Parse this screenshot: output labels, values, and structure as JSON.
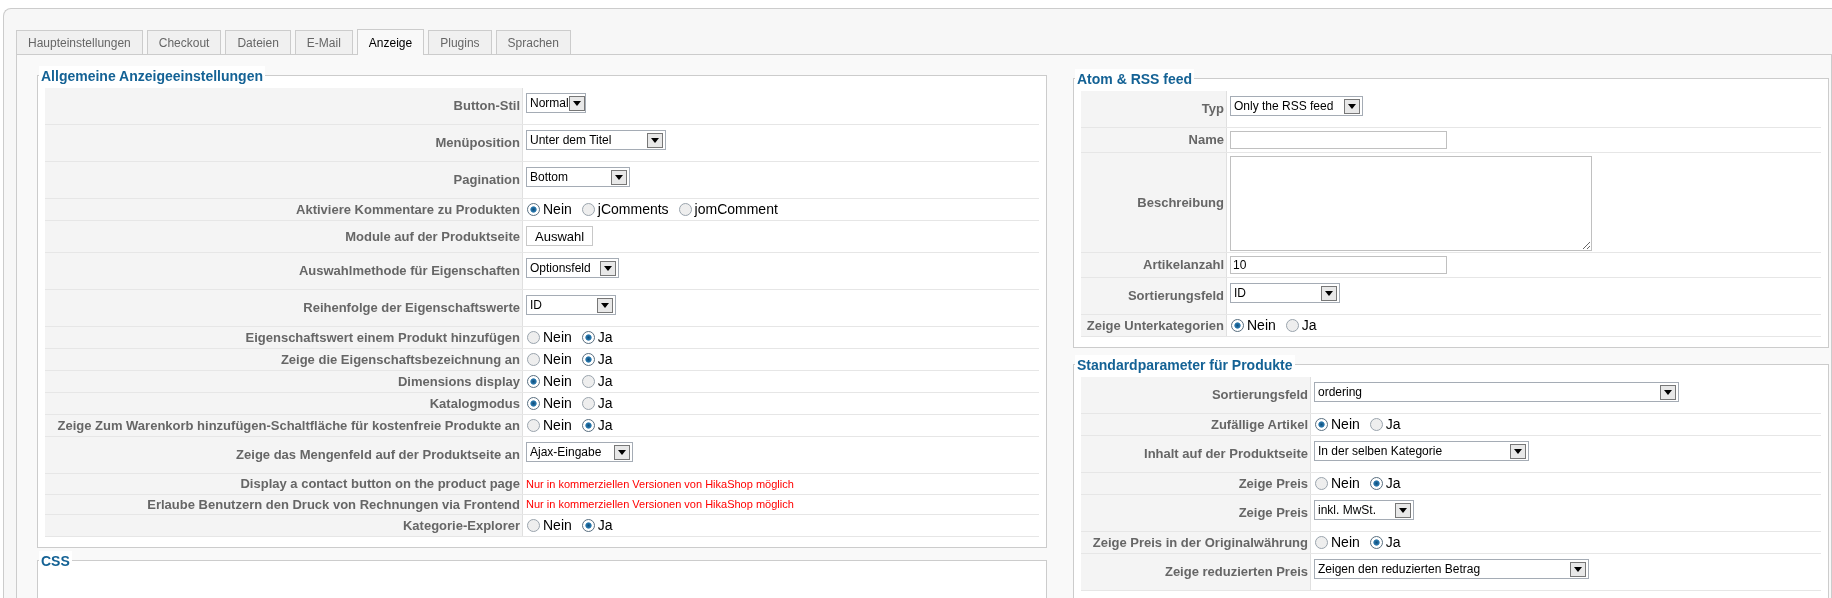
{
  "tabs": [
    {
      "label": "Haupteinstellungen",
      "selected": false
    },
    {
      "label": "Checkout",
      "selected": false
    },
    {
      "label": "Dateien",
      "selected": false
    },
    {
      "label": "E-Mail",
      "selected": false
    },
    {
      "label": "Anzeige",
      "selected": true
    },
    {
      "label": "Plugins",
      "selected": false
    },
    {
      "label": "Sprachen",
      "selected": false
    }
  ],
  "left_sections": [
    {
      "title": "Allgemeine Anzeigeeinstellungen",
      "rows": [
        {
          "label": "Button-Stil",
          "kind": "select",
          "value": "Normal"
        },
        {
          "label": "Menüposition",
          "kind": "select",
          "value": "Unter dem Titel"
        },
        {
          "label": "Pagination",
          "kind": "select",
          "value": "Bottom"
        },
        {
          "label": "Aktiviere Kommentare zu Produkten",
          "kind": "radio",
          "options": [
            {
              "label": "Nein",
              "selected": true
            },
            {
              "label": "jComments",
              "selected": false
            },
            {
              "label": "jomComment",
              "selected": false
            }
          ]
        },
        {
          "label": "Module auf der Produktseite",
          "kind": "button",
          "value": "Auswahl"
        },
        {
          "label": "Auswahlmethode für Eigenschaften",
          "kind": "select",
          "value": "Optionsfeld"
        },
        {
          "label": "Reihenfolge der Eigenschaftswerte",
          "kind": "select",
          "value": "ID"
        },
        {
          "label": "Eigenschaftswert einem Produkt hinzufügen",
          "kind": "radio",
          "options": [
            {
              "label": "Nein",
              "selected": false
            },
            {
              "label": "Ja",
              "selected": true
            }
          ]
        },
        {
          "label": "Zeige die Eigenschaftsbezeichnung an",
          "kind": "radio",
          "options": [
            {
              "label": "Nein",
              "selected": false
            },
            {
              "label": "Ja",
              "selected": true
            }
          ]
        },
        {
          "label": "Dimensions display",
          "kind": "radio",
          "options": [
            {
              "label": "Nein",
              "selected": true
            },
            {
              "label": "Ja",
              "selected": false
            }
          ]
        },
        {
          "label": "Katalogmodus",
          "kind": "radio",
          "options": [
            {
              "label": "Nein",
              "selected": true
            },
            {
              "label": "Ja",
              "selected": false
            }
          ]
        },
        {
          "label": "Zeige Zum Warenkorb hinzufügen-Schaltfläche für kostenfreie Produkte an",
          "kind": "radio",
          "options": [
            {
              "label": "Nein",
              "selected": false
            },
            {
              "label": "Ja",
              "selected": true
            }
          ]
        },
        {
          "label": "Zeige das Mengenfeld auf der Produktseite an",
          "kind": "select",
          "value": "Ajax-Eingabe"
        },
        {
          "label": "Display a contact button on the product page",
          "kind": "notice",
          "value": "Nur in kommerziellen Versionen von HikaShop möglich"
        },
        {
          "label": "Erlaube Benutzern den Druck von Rechnungen via Frontend",
          "kind": "notice",
          "value": "Nur in kommerziellen Versionen von HikaShop möglich"
        },
        {
          "label": "Kategorie-Explorer",
          "kind": "radio",
          "options": [
            {
              "label": "Nein",
              "selected": false
            },
            {
              "label": "Ja",
              "selected": true
            }
          ]
        }
      ]
    },
    {
      "title": "CSS"
    }
  ],
  "right_sections": [
    {
      "title": "Atom & RSS feed",
      "rows": [
        {
          "label": "Typ",
          "kind": "select",
          "value": "Only the RSS feed"
        },
        {
          "label": "Name",
          "kind": "text"
        },
        {
          "label": "Beschreibung",
          "kind": "textarea"
        },
        {
          "label": "Artikelanzahl",
          "kind": "text",
          "value": "10"
        },
        {
          "label": "Sortierungsfeld",
          "kind": "select",
          "value": "ID"
        },
        {
          "label": "Zeige Unterkategorien",
          "kind": "radio",
          "options": [
            {
              "label": "Nein",
              "selected": true
            },
            {
              "label": "Ja",
              "selected": false
            }
          ]
        }
      ]
    },
    {
      "title": "Standardparameter für Produkte",
      "rows": [
        {
          "label": "Sortierungsfeld",
          "kind": "select",
          "value": "ordering"
        },
        {
          "label": "Zufällige Artikel",
          "kind": "radio",
          "options": [
            {
              "label": "Nein",
              "selected": true
            },
            {
              "label": "Ja",
              "selected": false
            }
          ]
        },
        {
          "label": "Inhalt auf der Produktseite",
          "kind": "select",
          "value": "In der selben Kategorie"
        },
        {
          "label": "Zeige Preis",
          "kind": "radio",
          "options": [
            {
              "label": "Nein",
              "selected": false
            },
            {
              "label": "Ja",
              "selected": true
            }
          ]
        },
        {
          "label": "Zeige Preis",
          "kind": "select",
          "value": "inkl. MwSt."
        },
        {
          "label": "Zeige Preis in der Originalwährung",
          "kind": "radio",
          "options": [
            {
              "label": "Nein",
              "selected": false
            },
            {
              "label": "Ja",
              "selected": true
            }
          ]
        },
        {
          "label": "Zeige reduzierten Preis",
          "kind": "select",
          "value": "Zeigen den reduzierten Betrag"
        }
      ]
    }
  ]
}
